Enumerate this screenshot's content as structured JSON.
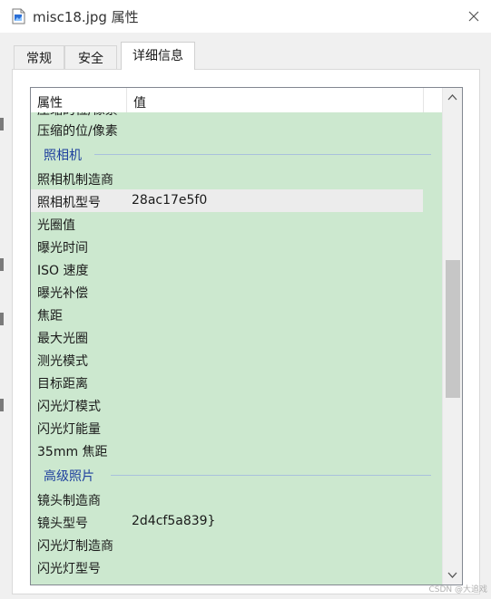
{
  "window": {
    "title": "misc18.jpg 属性"
  },
  "tabs": [
    {
      "label": "常规",
      "active": false
    },
    {
      "label": "安全",
      "active": false
    },
    {
      "label": "详细信息",
      "active": true
    }
  ],
  "columns": {
    "property": "属性",
    "value": "值"
  },
  "rows": {
    "compression": {
      "label": "压缩的位/像素",
      "value": ""
    },
    "camera_group": "照相机",
    "camera_maker": {
      "label": "照相机制造商",
      "value": ""
    },
    "camera_model": {
      "label": "照相机型号",
      "value": "28ac17e5f0"
    },
    "f_stop": {
      "label": "光圈值",
      "value": ""
    },
    "exposure_time": {
      "label": "曝光时间",
      "value": ""
    },
    "iso": {
      "label": "ISO 速度",
      "value": ""
    },
    "exposure_bias": {
      "label": "曝光补偿",
      "value": ""
    },
    "focal_length": {
      "label": "焦距",
      "value": ""
    },
    "max_aperture": {
      "label": "最大光圈",
      "value": ""
    },
    "metering_mode": {
      "label": "测光模式",
      "value": ""
    },
    "subject_distance": {
      "label": "目标距离",
      "value": ""
    },
    "flash_mode": {
      "label": "闪光灯模式",
      "value": ""
    },
    "flash_energy": {
      "label": "闪光灯能量",
      "value": ""
    },
    "focal_35mm": {
      "label": "35mm 焦距",
      "value": ""
    },
    "advanced_group": "高级照片",
    "lens_maker": {
      "label": "镜头制造商",
      "value": ""
    },
    "lens_model": {
      "label": "镜头型号",
      "value": "2d4cf5a839}"
    },
    "flash_maker": {
      "label": "闪光灯制造商",
      "value": ""
    },
    "flash_model": {
      "label": "闪光灯型号",
      "value": ""
    }
  },
  "watermark": "CSDN @大追戏",
  "colors": {
    "list_background": "#cce8cf",
    "group_text": "#1e3f9e",
    "selected_row": "#ececec"
  },
  "scrollbar": {
    "position_fraction": 0.35
  }
}
